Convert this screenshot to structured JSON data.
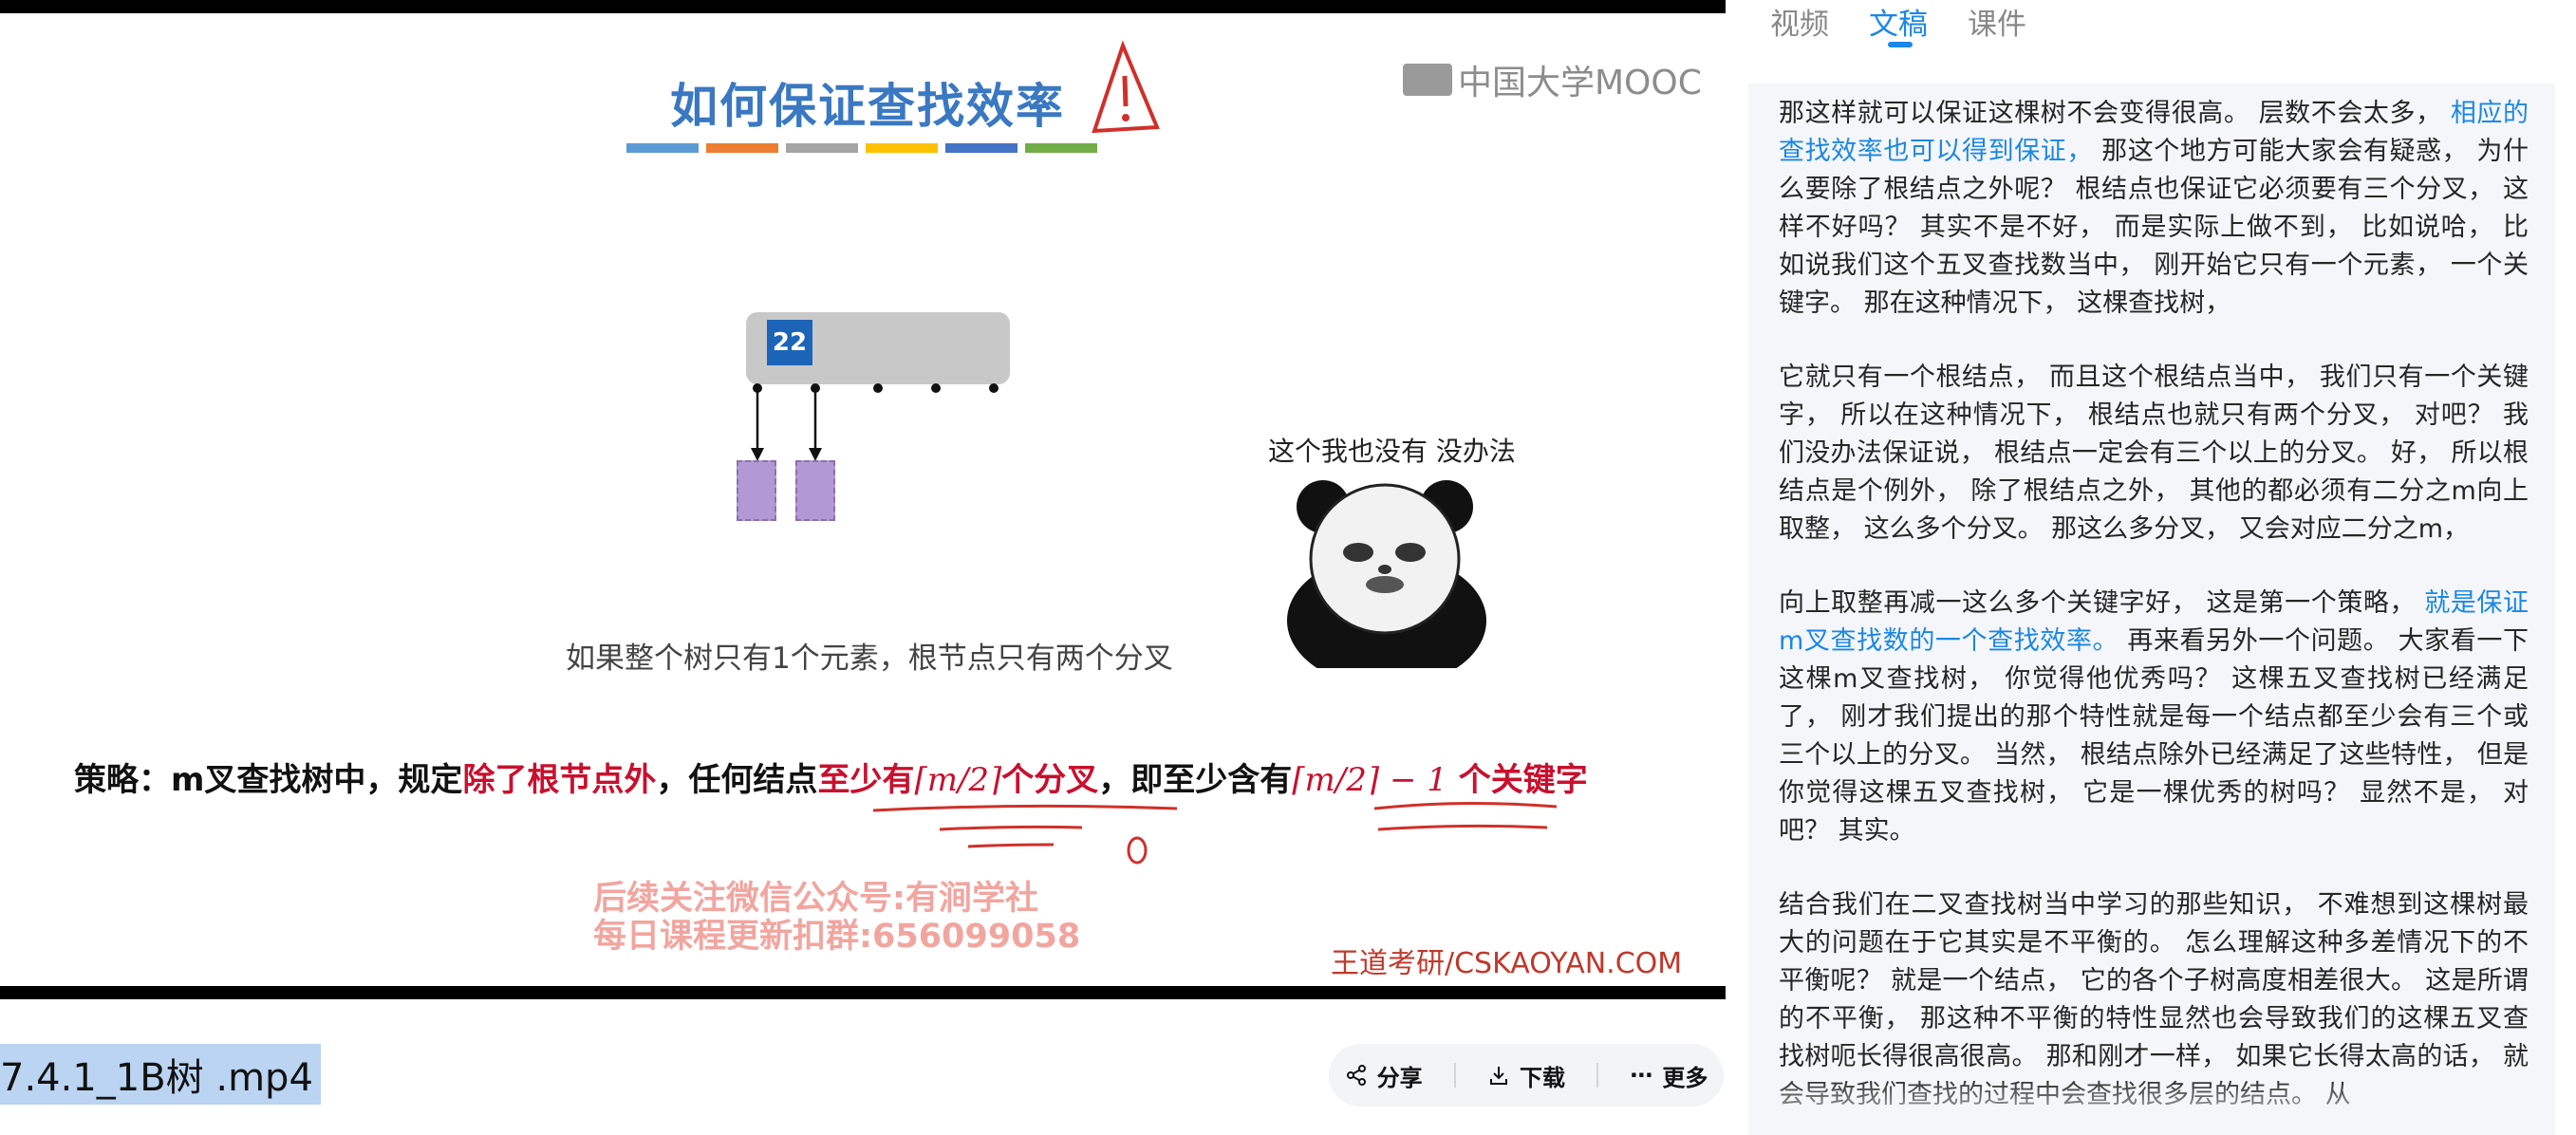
{
  "slide": {
    "title": "如何保证查找效率",
    "logo_text": "中国大学MOOC",
    "node_key": "22",
    "caption": "如果整个树只有1个元素，根节点只有两个分叉",
    "panda_caption": "这个我也没有 没办法",
    "strategy": {
      "prefix": "策略：m叉查找树中，规定",
      "red1": "除了根节点外",
      "mid": "，任何结点",
      "red2a": "至少有",
      "math1": "⌈m/2⌉",
      "red2b": "个分叉",
      "mid2": "，即至少含有",
      "math2": "⌈m/2⌉ − 1",
      "red3": " 个关键字"
    },
    "watermark_line1": "后续关注微信公众号:有涧学社",
    "watermark_line2": "每日课程更新扣群:656099058",
    "credit": "王道考研/CSKAOYAN.COM",
    "bar_colors": [
      "#5b9bd5",
      "#ed7d31",
      "#a5a5a5",
      "#ffc000",
      "#4472c4",
      "#70ad47"
    ]
  },
  "file": {
    "title": "7.4.1_1B树 .mp4"
  },
  "actions": {
    "share": "分享",
    "download": "下载",
    "more": "更多"
  },
  "tabs": [
    "视频",
    "文稿",
    "课件"
  ],
  "active_tab": "文稿",
  "transcript": {
    "p1a": "那这样就可以保证这棵树不会变得很高。 层数不会太多， ",
    "p1_hl": "相应的查找效率也可以得到保证，",
    "p1b": " 那这个地方可能大家会有疑惑， 为什么要除了根结点之外呢？ 根结点也保证它必须要有三个分叉， 这样不好吗？ 其实不是不好， 而是实际上做不到， 比如说哈， 比如说我们这个五叉查找数当中， 刚开始它只有一个元素， 一个关键字。 那在这种情况下， 这棵查找树，",
    "p2": "它就只有一个根结点， 而且这个根结点当中， 我们只有一个关键字， 所以在这种情况下， 根结点也就只有两个分叉， 对吧？ 我们没办法保证说， 根结点一定会有三个以上的分叉。 好， 所以根结点是个例外， 除了根结点之外， 其他的都必须有二分之m向上取整， 这么多个分叉。 那这么多分叉， 又会对应二分之m，",
    "p3a": "向上取整再减一这么多个关键字好， 这是第一个策略， ",
    "p3_hl": "就是保证m叉查找数的一个查找效率。",
    "p3b": " 再来看另外一个问题。 大家看一下这棵m叉查找树， 你觉得他优秀吗？ 这棵五叉查找树已经满足了， 刚才我们提出的那个特性就是每一个结点都至少会有三个或三个以上的分叉。 当然， 根结点除外已经满足了这些特性， 但是你觉得这棵五叉查找树， 它是一棵优秀的树吗？ 显然不是， 对吧？ 其实。",
    "p4": "结合我们在二叉查找树当中学习的那些知识， 不难想到这棵树最大的问题在于它其实是不平衡的。 怎么理解这种多差情况下的不平衡呢？ 就是一个结点， 它的各个子树高度相差很大。 这是所谓的不平衡， 那这种不平衡的特性显然也会导致我们的这棵五叉查找树呃长得很高很高。 那和刚才一样， 如果它长得太高的话， 就会导致我们查找的过程中会查找很多层的结点。 从"
  }
}
